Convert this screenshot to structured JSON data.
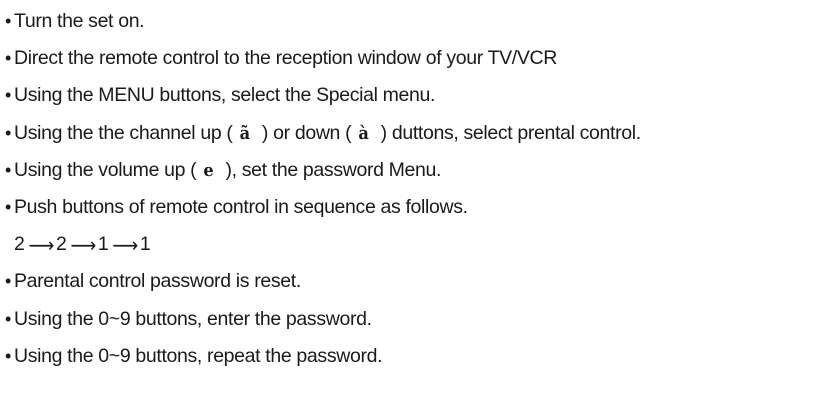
{
  "steps": [
    {
      "text": "Turn the set on."
    },
    {
      "text": "Direct the remote control to the reception window of your TV/VCR"
    },
    {
      "text": "Using the MENU buttons, select the Special menu."
    },
    {
      "pre": "Using the the channel up ( ",
      "glyph_up": "ã",
      "mid": "  ) or down ( ",
      "glyph_down": "à",
      "post": "  ) duttons, select prental control."
    },
    {
      "pre": "Using the volume up ( ",
      "glyph_vol": "e",
      "post": "  ), set the password Menu."
    },
    {
      "text": "Push buttons of remote control in sequence as follows."
    },
    {
      "text": "Parental control password is reset."
    },
    {
      "text": "Using the 0~9 buttons, enter the password."
    },
    {
      "text": "Using the 0~9 buttons, repeat the password."
    }
  ],
  "bullet": "•",
  "sequence": {
    "keys": [
      "2",
      "2",
      "1",
      "1"
    ],
    "arrow": "⟶"
  }
}
